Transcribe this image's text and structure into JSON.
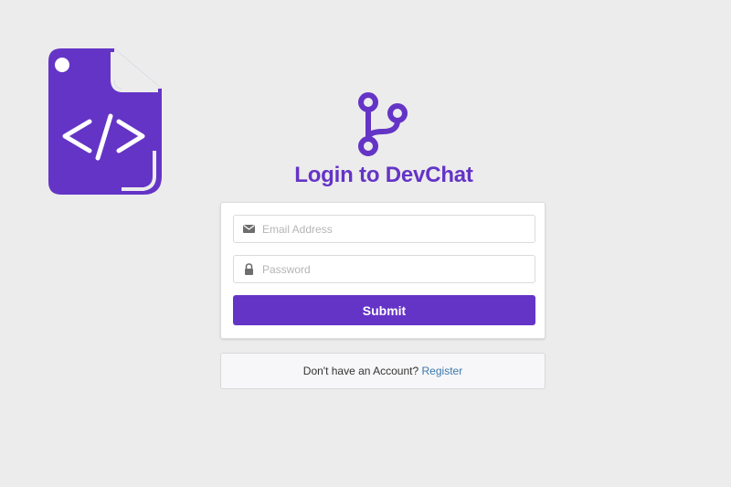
{
  "logo": {
    "icon": "code-file-icon"
  },
  "header": {
    "icon": "git-branch-icon",
    "title": "Login to DevChat"
  },
  "form": {
    "email": {
      "placeholder": "Email Address",
      "value": "",
      "icon": "envelope-icon"
    },
    "password": {
      "placeholder": "Password",
      "value": "",
      "icon": "lock-icon"
    },
    "submit_label": "Submit"
  },
  "footer": {
    "prompt": "Don't have an Account?",
    "link_label": "Register"
  },
  "colors": {
    "brand": "#6434c6",
    "link": "#3a78ad",
    "background": "#ececec"
  }
}
